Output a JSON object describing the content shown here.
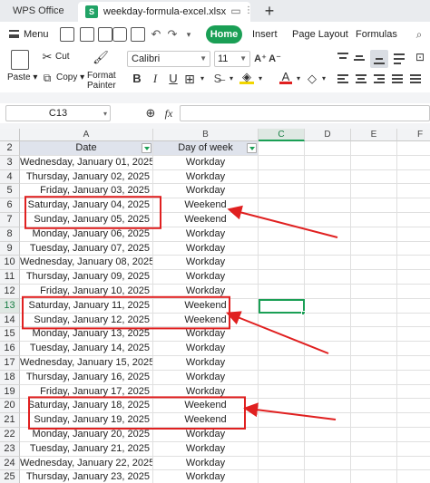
{
  "tabbar": {
    "app_label": "WPS Office",
    "doc_label": "weekday-formula-excel.xlsx",
    "add_label": "+"
  },
  "menubar": {
    "menu_label": "Menu",
    "tabs": [
      "Home",
      "Insert",
      "Page Layout",
      "Formulas"
    ]
  },
  "ribbon": {
    "cut": "Cut",
    "paste": "Paste",
    "copy": "Copy",
    "format_painter_1": "Format",
    "format_painter_2": "Painter",
    "font_name": "Calibri",
    "font_size": "11"
  },
  "formula_bar": {
    "name_box": "C13",
    "fx": "fx",
    "value": ""
  },
  "grid": {
    "columns": [
      "A",
      "B",
      "C",
      "D",
      "E",
      "F"
    ],
    "selected_column": "C",
    "selected_row": "13",
    "header_row": {
      "row": "2",
      "a": "Date",
      "b": "Day of week"
    },
    "rows": [
      {
        "row": "3",
        "date": "Wednesday, January 01, 2025",
        "day": "Workday"
      },
      {
        "row": "4",
        "date": "Thursday, January 02, 2025",
        "day": "Workday"
      },
      {
        "row": "5",
        "date": "Friday, January 03, 2025",
        "day": "Workday"
      },
      {
        "row": "6",
        "date": "Saturday, January 04, 2025",
        "day": "Weekend"
      },
      {
        "row": "7",
        "date": "Sunday, January 05, 2025",
        "day": "Weekend"
      },
      {
        "row": "8",
        "date": "Monday, January 06, 2025",
        "day": "Workday"
      },
      {
        "row": "9",
        "date": "Tuesday, January 07, 2025",
        "day": "Workday"
      },
      {
        "row": "10",
        "date": "Wednesday, January 08, 2025",
        "day": "Workday"
      },
      {
        "row": "11",
        "date": "Thursday, January 09, 2025",
        "day": "Workday"
      },
      {
        "row": "12",
        "date": "Friday, January 10, 2025",
        "day": "Workday"
      },
      {
        "row": "13",
        "date": "Saturday, January 11, 2025",
        "day": "Weekend"
      },
      {
        "row": "14",
        "date": "Sunday, January 12, 2025",
        "day": "Weekend"
      },
      {
        "row": "15",
        "date": "Monday, January 13, 2025",
        "day": "Workday"
      },
      {
        "row": "16",
        "date": "Tuesday, January 14, 2025",
        "day": "Workday"
      },
      {
        "row": "17",
        "date": "Wednesday, January 15, 2025",
        "day": "Workday"
      },
      {
        "row": "18",
        "date": "Thursday, January 16, 2025",
        "day": "Workday"
      },
      {
        "row": "19",
        "date": "Friday, January 17, 2025",
        "day": "Workday"
      },
      {
        "row": "20",
        "date": "Saturday, January 18, 2025",
        "day": "Weekend"
      },
      {
        "row": "21",
        "date": "Sunday, January 19, 2025",
        "day": "Weekend"
      },
      {
        "row": "22",
        "date": "Monday, January 20, 2025",
        "day": "Workday"
      },
      {
        "row": "23",
        "date": "Tuesday, January 21, 2025",
        "day": "Workday"
      },
      {
        "row": "24",
        "date": "Wednesday, January 22, 2025",
        "day": "Workday"
      },
      {
        "row": "25",
        "date": "Thursday, January 23, 2025",
        "day": "Workday"
      }
    ]
  },
  "annotations": {
    "color": "#e02020",
    "highlighted_rows": [
      [
        "6",
        "7"
      ],
      [
        "13",
        "14"
      ],
      [
        "20",
        "21"
      ]
    ]
  },
  "colors": {
    "accent": "#1a9f55",
    "header_fill": "#dfe3ec"
  }
}
